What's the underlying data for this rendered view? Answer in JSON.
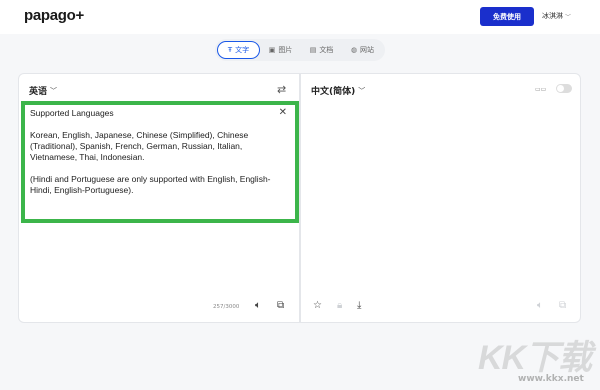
{
  "header": {
    "logo": "papago+",
    "free_button": "免费使用",
    "user_name": "冰淇淋",
    "chevron": "﹀"
  },
  "tabs": [
    {
      "label": "文字",
      "icon": "text-icon",
      "active": true
    },
    {
      "label": "图片",
      "icon": "image-icon",
      "active": false
    },
    {
      "label": "文档",
      "icon": "document-icon",
      "active": false
    },
    {
      "label": "网站",
      "icon": "globe-icon",
      "active": false
    }
  ],
  "source": {
    "language": "英语",
    "text_lines": [
      "Supported Languages",
      "Korean, English, Japanese, Chinese (Simplified), Chinese (Traditional), Spanish, French, German, Russian, Italian, Vietnamese, Thai, Indonesian.",
      "(Hindi and Portuguese are only supported with English, English-Hindi, English-Portuguese)."
    ],
    "char_count": "257/3000"
  },
  "target": {
    "language": "中文(简体)"
  },
  "colors": {
    "brand_blue": "#1a2fcc",
    "highlight_green": "#3cb54a",
    "active_tab": "#1a58e8"
  },
  "watermark": {
    "mark": "KK下载",
    "url": "www.kkx.net"
  }
}
